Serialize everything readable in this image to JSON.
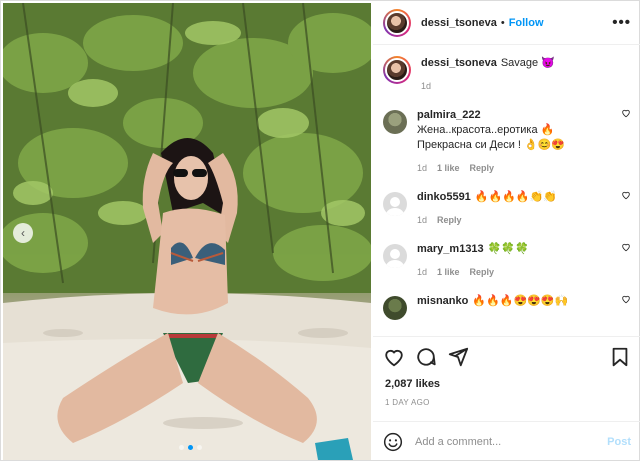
{
  "header": {
    "username": "dessi_tsoneva",
    "separator": "•",
    "follow_label": "Follow",
    "more_label": "•••"
  },
  "caption": {
    "username": "dessi_tsoneva",
    "text": "Savage 😈",
    "age": "1d"
  },
  "comments": [
    {
      "username": "palmira_222",
      "line1": "Жена..красота..еротика 🔥",
      "line2": "Прекрасна си Деси ! 👌😊😍",
      "age": "1d",
      "likes": "1 like",
      "reply": "Reply"
    },
    {
      "username": "dinko5591",
      "line1": "🔥🔥🔥🔥👏👏",
      "age": "1d",
      "reply": "Reply"
    },
    {
      "username": "mary_m1313",
      "line1": "🍀🍀🍀",
      "age": "1d",
      "likes": "1 like",
      "reply": "Reply"
    },
    {
      "username": "misnanko",
      "line1": "🔥🔥🔥😍😍😍🙌"
    }
  ],
  "stats": {
    "likes": "2,087 likes",
    "time": "1 DAY AGO"
  },
  "add_comment": {
    "placeholder": "Add a comment...",
    "post_label": "Post"
  },
  "carousel": {
    "total": 3,
    "active": 1
  },
  "colors": {
    "accent": "#0095f6",
    "text": "#262626",
    "muted": "#8e8e8e"
  }
}
